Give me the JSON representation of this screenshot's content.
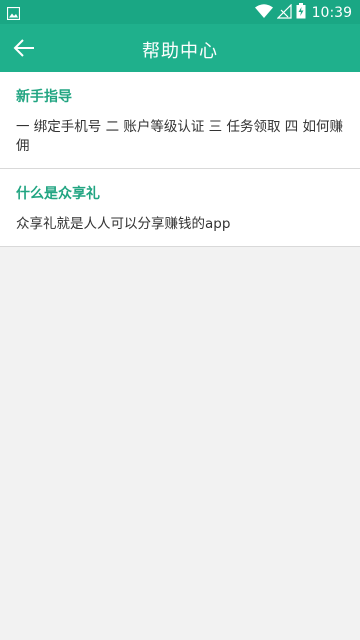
{
  "status_bar": {
    "time": "10:39",
    "icons": [
      "image-icon",
      "wifi-icon",
      "signal-icon",
      "battery-icon"
    ]
  },
  "app_bar": {
    "title": "帮助中心",
    "back_icon": "arrow-left-icon"
  },
  "sections": [
    {
      "heading": "新手指导",
      "body": "一 绑定手机号 二 账户等级认证 三 任务领取 四 如何赚佣"
    },
    {
      "heading": "什么是众享礼",
      "body": "众享礼就是人人可以分享赚钱的app"
    }
  ],
  "colors": {
    "status_bar": "#1aa784",
    "app_bar": "#1fb08c",
    "heading": "#22a582",
    "background": "#f2f2f2"
  }
}
